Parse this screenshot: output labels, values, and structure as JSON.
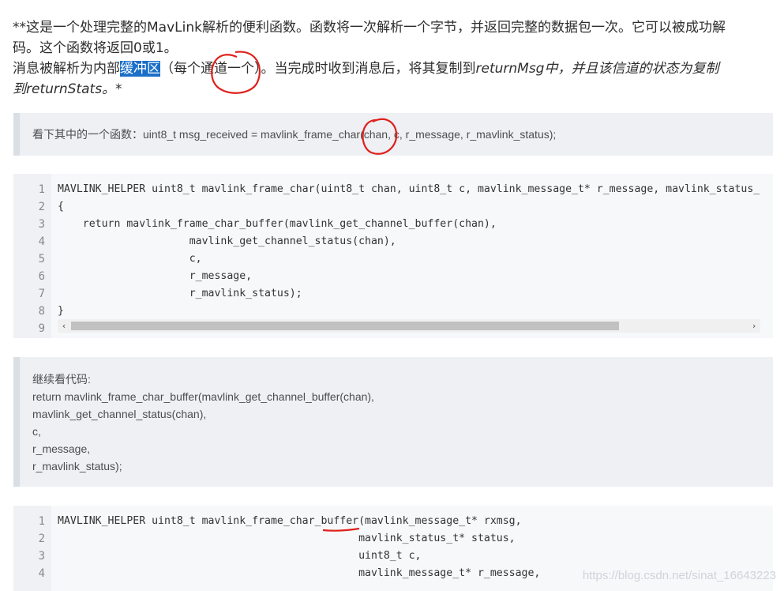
{
  "intro": {
    "line1": "**这是一个处理完整的MavLink解析的便利函数。函数将一次解析一个字节，并返回完整的数据包一次。它可以被成功解",
    "line2": "码。这个函数将返回0或1。",
    "line3_pre": "消息被解析为内部",
    "line3_hl": "缓冲区",
    "line3_post": "（每个通道一个）。当完成时收到消息后，将其复制到",
    "line3_it": "returnMsg中，并且该信道的状态为复制",
    "line4_it": "到returnStats。*"
  },
  "quote1": {
    "text": "看下其中的一个函数：uint8_t msg_received = mavlink_frame_char(chan, c, r_message, r_mavlink_status);"
  },
  "code1": {
    "lines": [
      {
        "n": "1",
        "t": "MAVLINK_HELPER uint8_t mavlink_frame_char(uint8_t chan, uint8_t c, mavlink_message_t* r_message, mavlink_status_"
      },
      {
        "n": "2",
        "t": "{"
      },
      {
        "n": "3",
        "t": "    return mavlink_frame_char_buffer(mavlink_get_channel_buffer(chan),"
      },
      {
        "n": "4",
        "t": "                     mavlink_get_channel_status(chan),"
      },
      {
        "n": "5",
        "t": "                     c,"
      },
      {
        "n": "6",
        "t": "                     r_message,"
      },
      {
        "n": "7",
        "t": "                     r_mavlink_status);"
      },
      {
        "n": "8",
        "t": "}"
      },
      {
        "n": "9",
        "t": ""
      }
    ],
    "scroll_left": "‹",
    "scroll_right": "›"
  },
  "quote2": {
    "lines": [
      "继续看代码:",
      "return mavlink_frame_char_buffer(mavlink_get_channel_buffer(chan),",
      "mavlink_get_channel_status(chan),",
      "c,",
      "r_message,",
      "r_mavlink_status);"
    ]
  },
  "code2": {
    "lines": [
      {
        "n": "1",
        "t": "MAVLINK_HELPER uint8_t mavlink_frame_char_buffer(mavlink_message_t* rxmsg,"
      },
      {
        "n": "2",
        "t": "                                                mavlink_status_t* status,"
      },
      {
        "n": "3",
        "t": "                                                uint8_t c,"
      },
      {
        "n": "4",
        "t": "                                                mavlink_message_t* r_message,"
      }
    ]
  },
  "watermark": "https://blog.csdn.net/sinat_16643223"
}
